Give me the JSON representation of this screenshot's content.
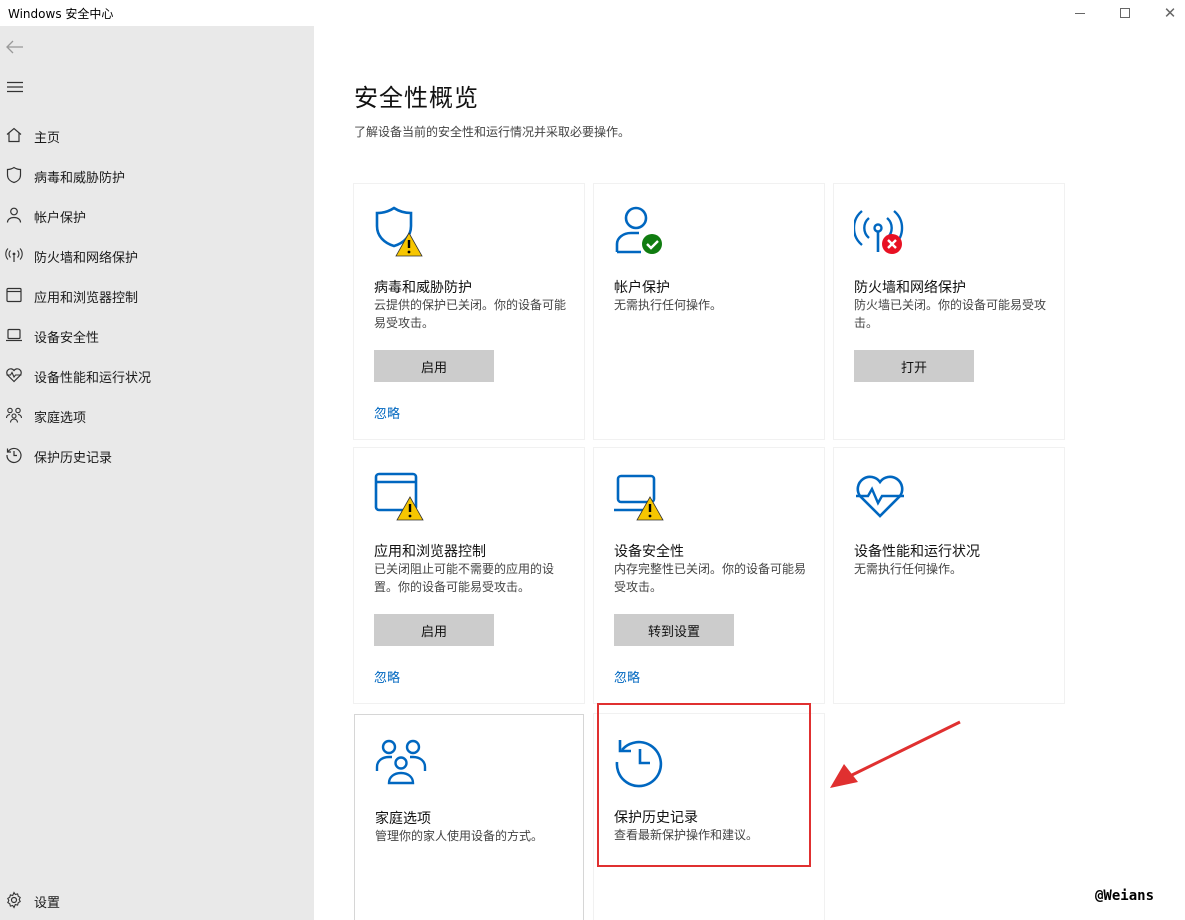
{
  "window": {
    "title": "Windows 安全中心"
  },
  "sidebar": {
    "items": [
      {
        "label": "主页",
        "icon": "home-icon"
      },
      {
        "label": "病毒和威胁防护",
        "icon": "shield-icon"
      },
      {
        "label": "帐户保护",
        "icon": "person-icon"
      },
      {
        "label": "防火墙和网络保护",
        "icon": "antenna-icon"
      },
      {
        "label": "应用和浏览器控制",
        "icon": "browser-window-icon"
      },
      {
        "label": "设备安全性",
        "icon": "laptop-icon"
      },
      {
        "label": "设备性能和运行状况",
        "icon": "heart-pulse-icon"
      },
      {
        "label": "家庭选项",
        "icon": "family-icon"
      },
      {
        "label": "保护历史记录",
        "icon": "history-icon"
      }
    ],
    "settings_label": "设置"
  },
  "main": {
    "title": "安全性概览",
    "subtitle": "了解设备当前的安全性和运行情况并采取必要操作。",
    "tiles": [
      {
        "title": "病毒和威胁防护",
        "desc": "云提供的保护已关闭。你的设备可能易受攻击。",
        "button": "启用",
        "link": "忽略",
        "status": "warning"
      },
      {
        "title": "帐户保护",
        "desc": "无需执行任何操作。",
        "status": "ok"
      },
      {
        "title": "防火墙和网络保护",
        "desc": "防火墙已关闭。你的设备可能易受攻击。",
        "button": "打开",
        "status": "error"
      },
      {
        "title": "应用和浏览器控制",
        "desc": "已关闭阻止可能不需要的应用的设置。你的设备可能易受攻击。",
        "button": "启用",
        "link": "忽略",
        "status": "warning"
      },
      {
        "title": "设备安全性",
        "desc": "内存完整性已关闭。你的设备可能易受攻击。",
        "button": "转到设置",
        "link": "忽略",
        "status": "warning"
      },
      {
        "title": "设备性能和运行状况",
        "desc": "无需执行任何操作。",
        "status": "ok"
      },
      {
        "title": "家庭选项",
        "desc": "管理你的家人使用设备的方式。"
      },
      {
        "title": "保护历史记录",
        "desc": "查看最新保护操作和建议。"
      }
    ]
  },
  "watermark": "@Weians",
  "colors": {
    "accent": "#0067c0",
    "warning": "#f7c600",
    "ok": "#107c10",
    "error": "#e81123",
    "highlight": "#e03030"
  }
}
